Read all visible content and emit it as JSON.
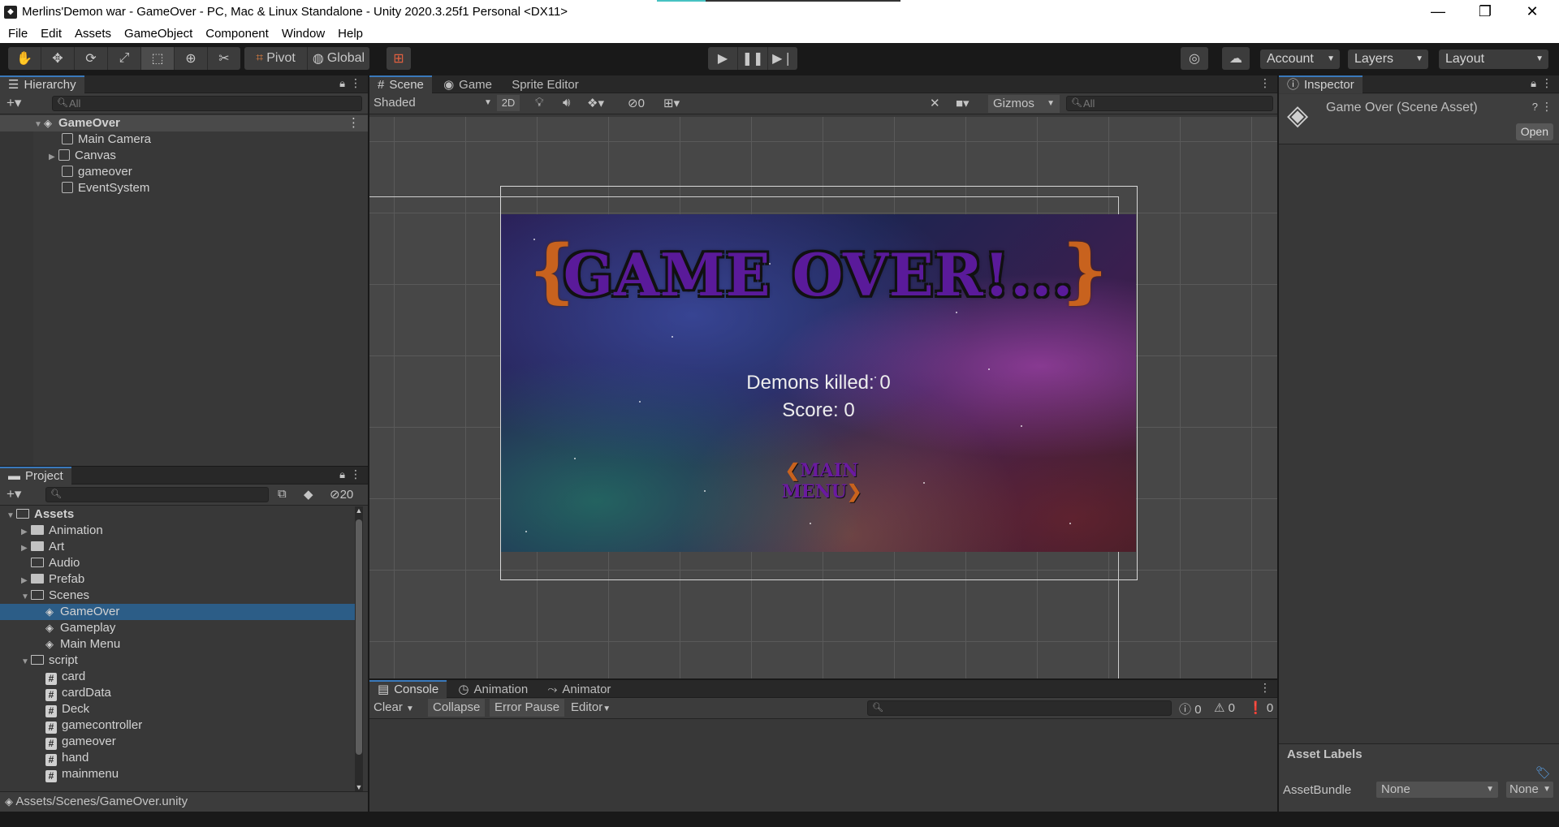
{
  "window": {
    "title": "Merlins'Demon war - GameOver - PC, Mac & Linux Standalone - Unity 2020.3.25f1 Personal <DX11>",
    "minimize": "—",
    "restore": "❐",
    "close": "✕"
  },
  "menu": [
    "File",
    "Edit",
    "Assets",
    "GameObject",
    "Component",
    "Window",
    "Help"
  ],
  "toolbar": {
    "pivot": "Pivot",
    "global": "Global",
    "account": "Account",
    "layers": "Layers",
    "layout": "Layout"
  },
  "hierarchy": {
    "tab": "Hierarchy",
    "search_placeholder": "All",
    "scene": "GameOver",
    "items": [
      "Main Camera",
      "Canvas",
      "gameover",
      "EventSystem"
    ]
  },
  "project": {
    "tab": "Project",
    "hidden_count": "20",
    "tree": [
      {
        "label": "Assets",
        "depth": 0,
        "type": "folder-open",
        "caret": "▼"
      },
      {
        "label": "Animation",
        "depth": 1,
        "type": "folder",
        "caret": "▶"
      },
      {
        "label": "Art",
        "depth": 1,
        "type": "folder",
        "caret": "▶"
      },
      {
        "label": "Audio",
        "depth": 1,
        "type": "folder-empty",
        "caret": ""
      },
      {
        "label": "Prefab",
        "depth": 1,
        "type": "folder",
        "caret": "▶"
      },
      {
        "label": "Scenes",
        "depth": 1,
        "type": "folder-open",
        "caret": "▼"
      },
      {
        "label": "GameOver",
        "depth": 2,
        "type": "scene",
        "caret": "",
        "selected": true
      },
      {
        "label": "Gameplay",
        "depth": 2,
        "type": "scene",
        "caret": ""
      },
      {
        "label": "Main Menu",
        "depth": 2,
        "type": "scene",
        "caret": ""
      },
      {
        "label": "script",
        "depth": 1,
        "type": "folder-open",
        "caret": "▼"
      },
      {
        "label": "card",
        "depth": 2,
        "type": "script",
        "caret": ""
      },
      {
        "label": "cardData",
        "depth": 2,
        "type": "script",
        "caret": ""
      },
      {
        "label": "Deck",
        "depth": 2,
        "type": "script",
        "caret": ""
      },
      {
        "label": "gamecontroller",
        "depth": 2,
        "type": "script",
        "caret": ""
      },
      {
        "label": "gameover",
        "depth": 2,
        "type": "script",
        "caret": ""
      },
      {
        "label": "hand",
        "depth": 2,
        "type": "script",
        "caret": ""
      },
      {
        "label": "mainmenu",
        "depth": 2,
        "type": "script",
        "caret": ""
      }
    ],
    "path": "Assets/Scenes/GameOver.unity"
  },
  "scene": {
    "tabs": [
      "Scene",
      "Game",
      "Sprite Editor"
    ],
    "shading": "Shaded",
    "mode_2d": "2D",
    "hidden_count": "0",
    "gizmos": "Gizmos",
    "search_placeholder": "All"
  },
  "game": {
    "title": "GAME OVER!...",
    "demons_killed": "Demons killed: 0",
    "score": "Score: 0",
    "main_menu": "MAIN MENU"
  },
  "console": {
    "tabs": [
      "Console",
      "Animation",
      "Animator"
    ],
    "clear": "Clear",
    "collapse": "Collapse",
    "error_pause": "Error Pause",
    "editor": "Editor",
    "info_count": "0",
    "warn_count": "0",
    "error_count": "0"
  },
  "inspector": {
    "tab": "Inspector",
    "asset_title": "Game Over (Scene Asset)",
    "open": "Open",
    "asset_labels": "Asset Labels",
    "assetbundle_label": "AssetBundle",
    "assetbundle_value": "None",
    "variant_value": "None"
  },
  "colors": {
    "selection": "#2c5d87",
    "panel": "#383838",
    "accent_orange": "#c8621e",
    "title_purple": "#5a1a9a"
  }
}
